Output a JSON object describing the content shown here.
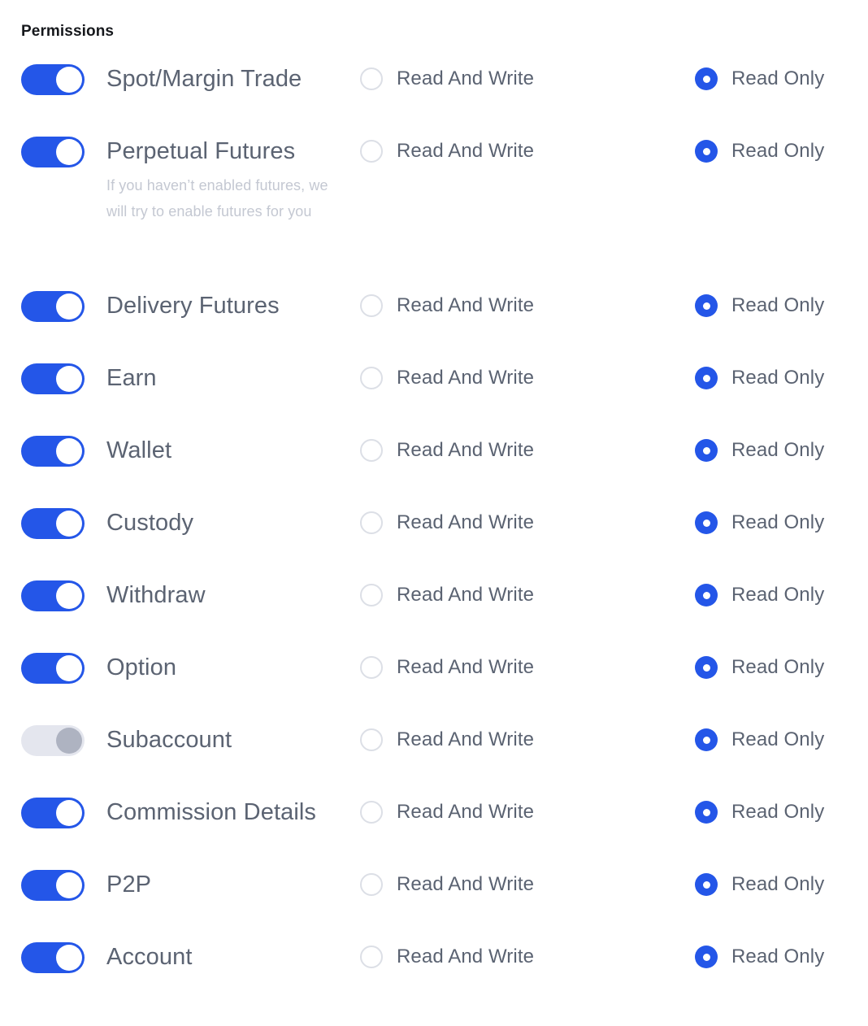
{
  "section": {
    "title": "Permissions"
  },
  "options": {
    "read_and_write_label": "Read And Write",
    "read_only_label": "Read Only"
  },
  "colors": {
    "toggle_on": "#2456e8",
    "toggle_off_track": "#e4e6ee",
    "toggle_off_knob": "#aeb3c1",
    "radio_selected": "#2456e8",
    "radio_unselected_border": "#dcdfe6",
    "label_text": "#5b6372",
    "hint_text": "#c4c8d2",
    "title_text": "#16181c",
    "background": "#ffffff"
  },
  "permissions": [
    {
      "name": "Spot/Margin Trade",
      "enabled": true,
      "toggle_disabled": false,
      "hint": "",
      "access": "Read Only",
      "read_and_write_selected": false,
      "read_only_selected": true
    },
    {
      "name": "Perpetual Futures",
      "enabled": true,
      "toggle_disabled": false,
      "hint": "If you haven’t enabled futures, we will try to enable futures for you",
      "access": "Read Only",
      "read_and_write_selected": false,
      "read_only_selected": true
    },
    {
      "name": "Delivery Futures",
      "enabled": true,
      "toggle_disabled": false,
      "hint": "",
      "access": "Read Only",
      "read_and_write_selected": false,
      "read_only_selected": true
    },
    {
      "name": "Earn",
      "enabled": true,
      "toggle_disabled": false,
      "hint": "",
      "access": "Read Only",
      "read_and_write_selected": false,
      "read_only_selected": true
    },
    {
      "name": "Wallet",
      "enabled": true,
      "toggle_disabled": false,
      "hint": "",
      "access": "Read Only",
      "read_and_write_selected": false,
      "read_only_selected": true
    },
    {
      "name": "Custody",
      "enabled": true,
      "toggle_disabled": false,
      "hint": "",
      "access": "Read Only",
      "read_and_write_selected": false,
      "read_only_selected": true
    },
    {
      "name": "Withdraw",
      "enabled": true,
      "toggle_disabled": false,
      "hint": "",
      "access": "Read Only",
      "read_and_write_selected": false,
      "read_only_selected": true
    },
    {
      "name": "Option",
      "enabled": true,
      "toggle_disabled": false,
      "hint": "",
      "access": "Read Only",
      "read_and_write_selected": false,
      "read_only_selected": true
    },
    {
      "name": "Subaccount",
      "enabled": false,
      "toggle_disabled": true,
      "hint": "",
      "access": "Read Only",
      "read_and_write_selected": false,
      "read_only_selected": true
    },
    {
      "name": "Commission Details",
      "enabled": true,
      "toggle_disabled": false,
      "hint": "",
      "access": "Read Only",
      "read_and_write_selected": false,
      "read_only_selected": true
    },
    {
      "name": "P2P",
      "enabled": true,
      "toggle_disabled": false,
      "hint": "",
      "access": "Read Only",
      "read_and_write_selected": false,
      "read_only_selected": true
    },
    {
      "name": "Account",
      "enabled": true,
      "toggle_disabled": false,
      "hint": "",
      "access": "Read Only",
      "read_and_write_selected": false,
      "read_only_selected": true
    }
  ]
}
